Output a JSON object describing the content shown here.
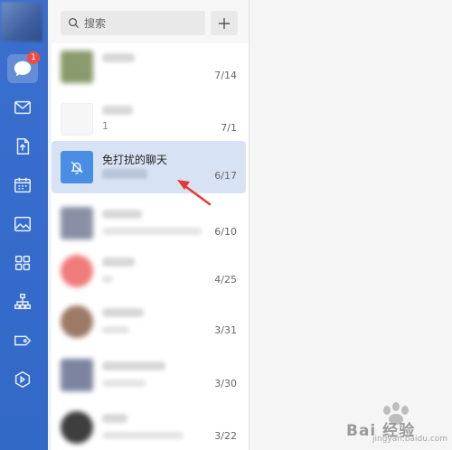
{
  "search": {
    "label": "搜索"
  },
  "chats": [
    {
      "date": "7/14",
      "color": "#8a9a6c"
    },
    {
      "date": "7/1",
      "preview": "1",
      "color": "#f6f6f6"
    },
    {
      "title": "免打扰的聊天",
      "date": "6/17",
      "selected": true
    },
    {
      "date": "6/10",
      "color": "#8a8fa6"
    },
    {
      "date": "4/25",
      "color": "#f07c7c"
    },
    {
      "date": "3/31",
      "color": "#9c7a66"
    },
    {
      "date": "3/30",
      "color": "#7c84a0"
    },
    {
      "date": "3/22",
      "color": "#3e3e3e"
    }
  ],
  "sidebar": {
    "badge_count": "1",
    "items": [
      {
        "icon": "chat-bubble-icon",
        "active": true
      },
      {
        "icon": "mail-icon"
      },
      {
        "icon": "document-icon"
      },
      {
        "icon": "calendar-icon"
      },
      {
        "icon": "photo-icon"
      },
      {
        "icon": "grid-apps-icon"
      },
      {
        "icon": "org-chart-icon"
      },
      {
        "icon": "tag-icon"
      },
      {
        "icon": "hexagon-icon"
      }
    ]
  },
  "watermark": {
    "text": "Bai 经验",
    "sub": "jingyan.baidu.com"
  },
  "colors": {
    "rail": "#3a6fd0",
    "selected_row": "#d7e3f5",
    "muted_icon": "#4a8de5",
    "badge": "#f04d3f",
    "arrow": "#e53935"
  }
}
